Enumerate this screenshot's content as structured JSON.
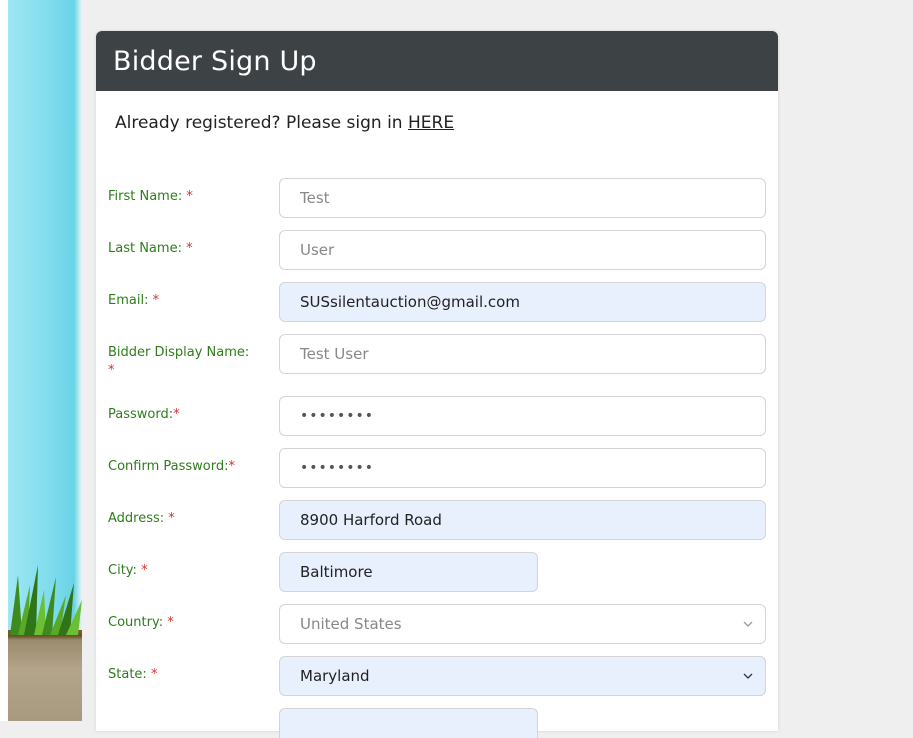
{
  "form": {
    "title": "Bidder Sign Up",
    "signin_prefix": "Already registered? Please sign in ",
    "signin_link": "HERE",
    "required_marker": "*",
    "fields": {
      "first_name": {
        "label": "First Name:",
        "value": "Test"
      },
      "last_name": {
        "label": "Last Name:",
        "value": "User"
      },
      "email": {
        "label": "Email:",
        "value": "SUSsilentauction@gmail.com"
      },
      "display_name": {
        "label": "Bidder Display Name:",
        "value": "Test User"
      },
      "password": {
        "label": "Password:",
        "value": "••••••••"
      },
      "confirm_password": {
        "label": "Confirm Password:",
        "value": "••••••••"
      },
      "address": {
        "label": "Address:",
        "value": "8900 Harford Road"
      },
      "city": {
        "label": "City:",
        "value": "Baltimore"
      },
      "country": {
        "label": "Country:",
        "value": "United States"
      },
      "state": {
        "label": "State:",
        "value": "Maryland"
      }
    }
  },
  "colors": {
    "header_bg": "#3d4245",
    "label_green": "#2e7d1b",
    "required_red": "#d9302c",
    "autofill_bg": "#e8f0fe"
  }
}
